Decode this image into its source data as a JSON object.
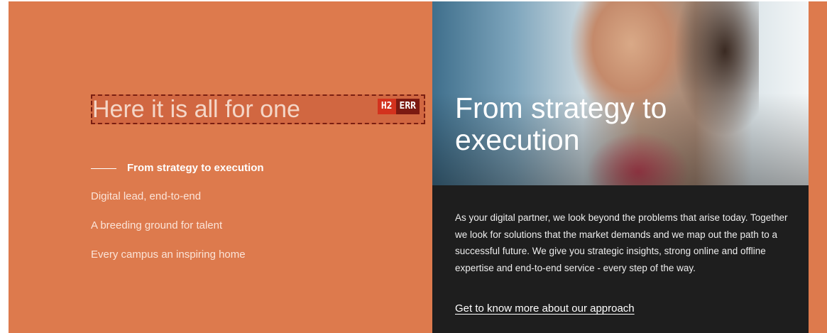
{
  "left": {
    "heading": "Here it is all for one",
    "badges": {
      "h2": "H2",
      "err": "ERR"
    },
    "nav": {
      "active": "From strategy to execution",
      "items": [
        "Digital lead, end-to-end",
        "A breeding ground for talent",
        "Every campus an inspiring home"
      ]
    }
  },
  "right": {
    "title": "From strategy to execution",
    "paragraph": "As your digital partner, we look beyond the problems that arise today. Together we look for solutions that the market demands and we map out the path to a successful future. We give you strategic insights, strong online and offline expertise and end-to-end service - every step of the way.",
    "link": "Get to know more about our approach"
  },
  "colors": {
    "accent": "#dd7a4d",
    "dark_panel": "#1e1e1e",
    "error_badge": "#d3321e",
    "error_badge_dark": "#7c1a12"
  }
}
